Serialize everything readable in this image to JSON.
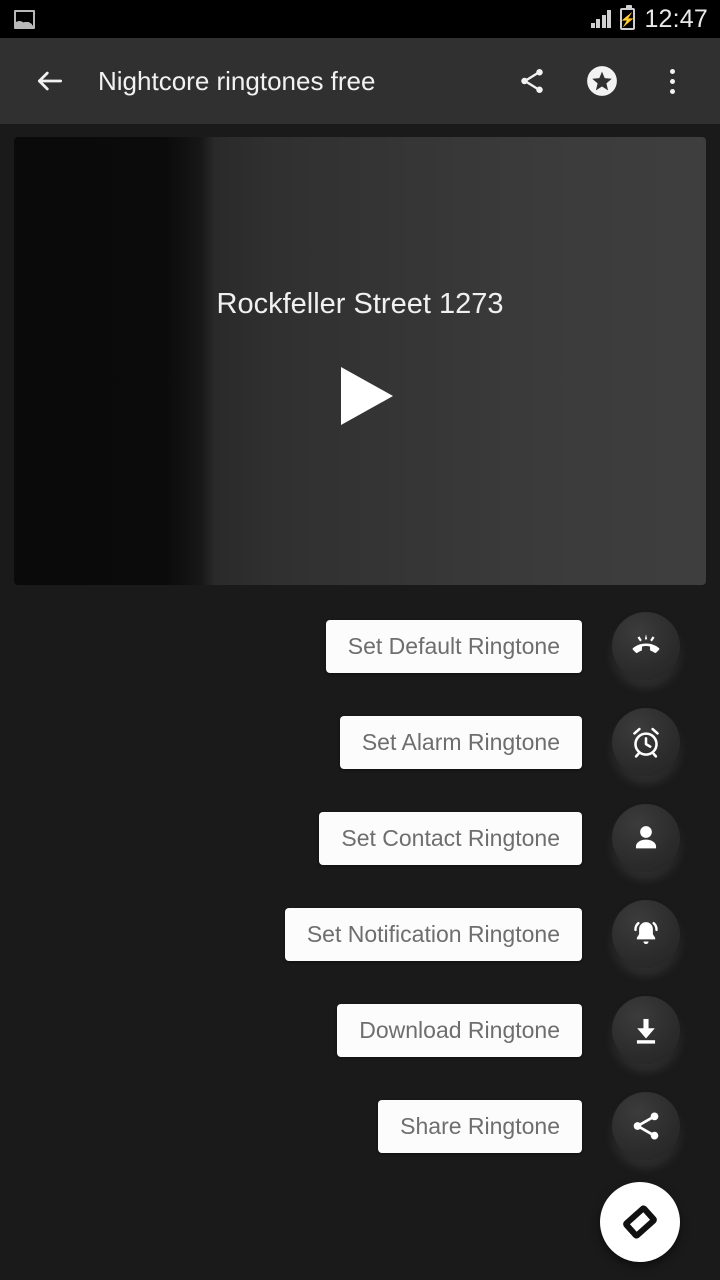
{
  "status_bar": {
    "notification_icon": "gallery-image-icon",
    "signal_icon": "signal-bars-icon",
    "battery_icon": "battery-charging-icon",
    "clock": "12:47"
  },
  "toolbar": {
    "back_icon": "arrow-back-icon",
    "title": "Nightcore ringtones free",
    "share_icon": "share-icon",
    "favorite_icon": "star-circle-icon",
    "overflow_icon": "more-vertical-icon"
  },
  "player": {
    "title": "Rockfeller Street 1273",
    "play_icon": "play-triangle-icon"
  },
  "actions": [
    {
      "label": "Set Default Ringtone",
      "icon": "ring-volume-icon"
    },
    {
      "label": "Set Alarm Ringtone",
      "icon": "alarm-clock-icon"
    },
    {
      "label": "Set Contact Ringtone",
      "icon": "person-icon"
    },
    {
      "label": "Set Notification Ringtone",
      "icon": "notification-bell-icon"
    },
    {
      "label": "Download Ringtone",
      "icon": "download-icon"
    },
    {
      "label": "Share Ringtone",
      "icon": "share-icon"
    }
  ],
  "fab": {
    "icon": "tag-diamond-icon"
  },
  "colors": {
    "background": "#1a1a1a",
    "toolbar": "#303030",
    "status_bar": "#000000",
    "button_surface": "#fcfcfc",
    "button_text": "#6e6e6e",
    "circle_surface": "#2b2b2b",
    "accent_white": "#ffffff"
  }
}
